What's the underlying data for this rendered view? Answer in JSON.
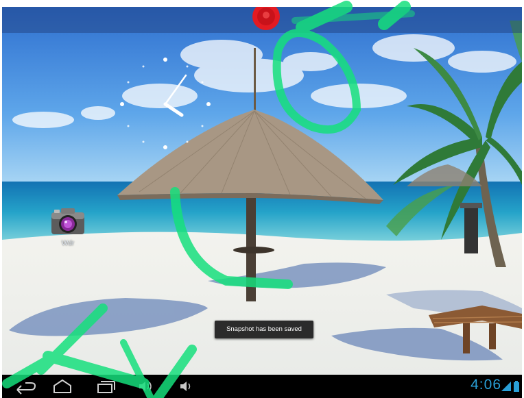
{
  "toast": {
    "text": "Snapshot has been saved"
  },
  "shortcuts": [
    {
      "label": "Wdr",
      "icon": "camera-icon"
    }
  ],
  "status": {
    "time": "4:06"
  },
  "nav": {
    "buttons": [
      "back-icon",
      "home-icon",
      "recent-apps-icon",
      "volume-down-icon",
      "volume-up-icon"
    ]
  },
  "colors": {
    "accent": "#2aa0d8",
    "record": "#e31b22",
    "watermark": "#16e07c"
  }
}
